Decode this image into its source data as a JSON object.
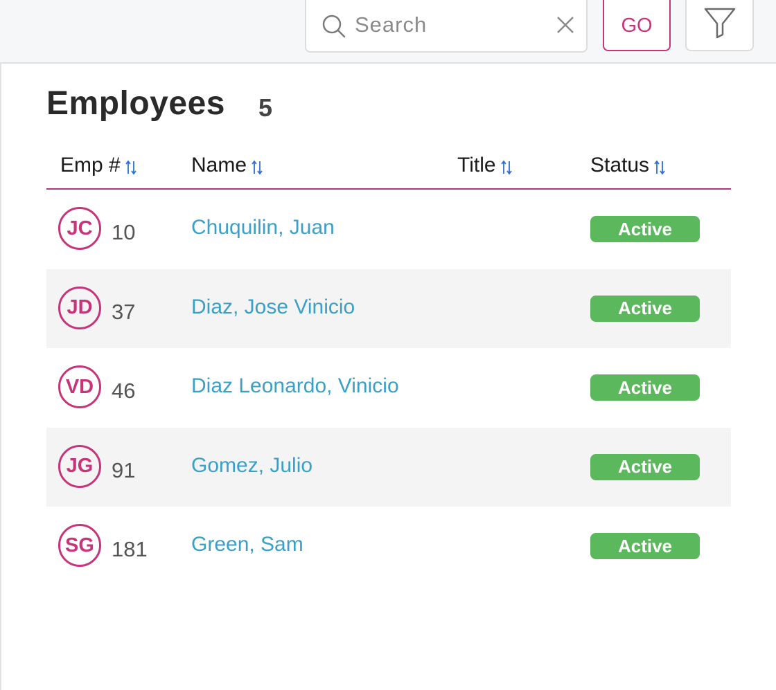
{
  "toolbar": {
    "search_placeholder": "Search",
    "search_value": "",
    "go_label": "GO"
  },
  "page": {
    "title": "Employees",
    "count": "5"
  },
  "table": {
    "columns": [
      {
        "label": "Emp #"
      },
      {
        "label": "Name"
      },
      {
        "label": "Title"
      },
      {
        "label": "Status"
      }
    ],
    "rows": [
      {
        "initials": "JC",
        "emp_num": "10",
        "name": "Chuquilin, Juan",
        "title": "",
        "status": "Active"
      },
      {
        "initials": "JD",
        "emp_num": "37",
        "name": "Diaz, Jose Vinicio",
        "title": "",
        "status": "Active"
      },
      {
        "initials": "VD",
        "emp_num": "46",
        "name": "Diaz Leonardo, Vinicio",
        "title": "",
        "status": "Active"
      },
      {
        "initials": "JG",
        "emp_num": "91",
        "name": "Gomez, Julio",
        "title": "",
        "status": "Active"
      },
      {
        "initials": "SG",
        "emp_num": "181",
        "name": "Green, Sam",
        "title": "",
        "status": "Active"
      }
    ]
  },
  "colors": {
    "accent": "#c8347a",
    "link": "#3aa0c8",
    "status_active": "#5cb85c",
    "sort_icon": "#2a6fd6"
  },
  "icons": [
    "search-icon",
    "clear-icon",
    "filter-icon",
    "sort-icon"
  ]
}
